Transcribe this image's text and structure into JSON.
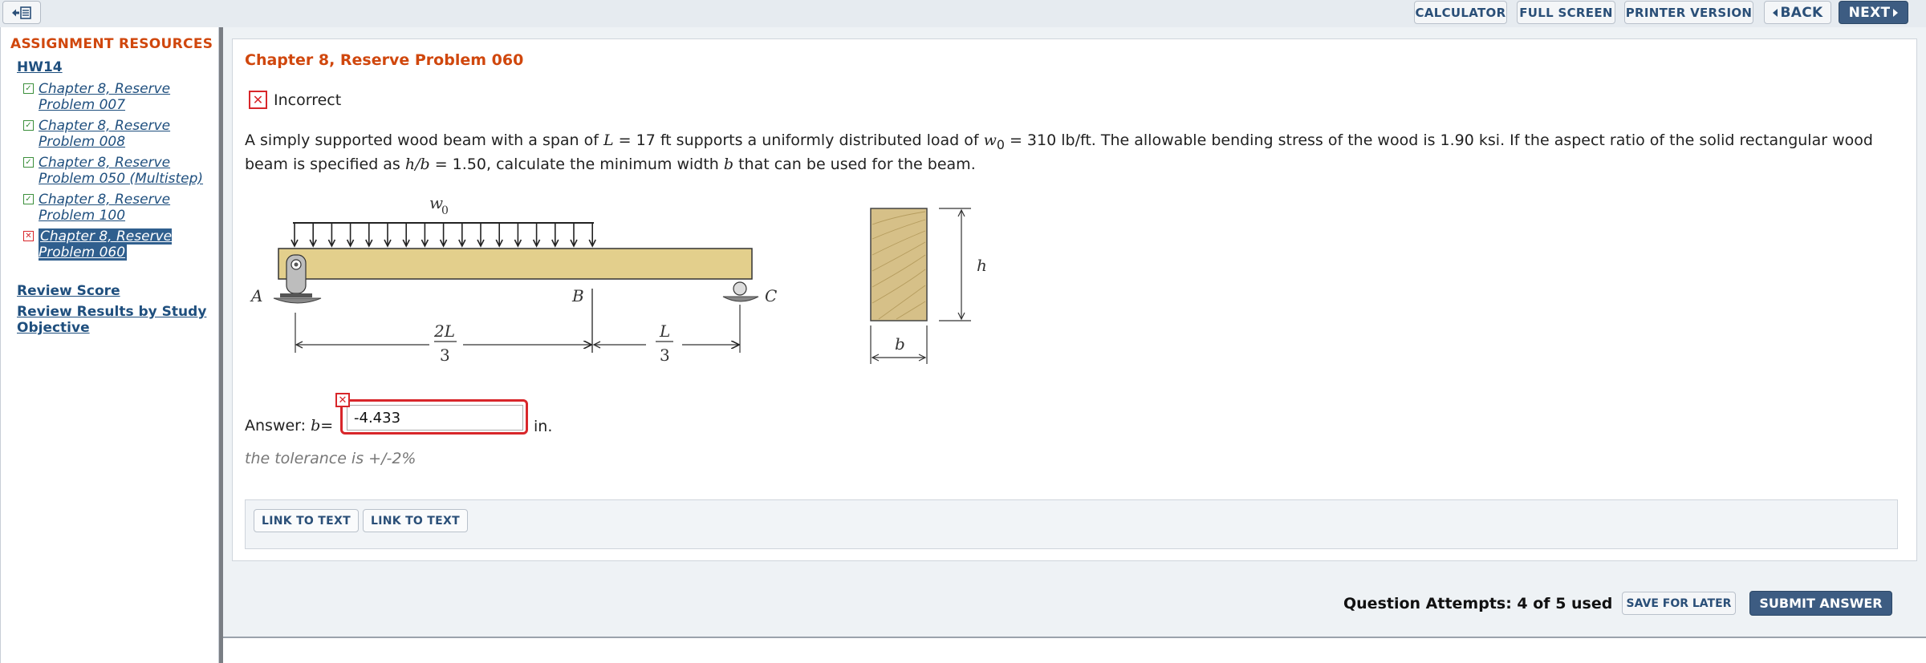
{
  "toolbar": {
    "collapse_icon": "sidebar-toggle-icon",
    "calculator": "CALCULATOR",
    "full_screen": "FULL SCREEN",
    "printer_version": "PRINTER VERSION",
    "back": "BACK",
    "next": "NEXT"
  },
  "sidebar": {
    "title": "ASSIGNMENT RESOURCES",
    "assignment": "HW14",
    "items": [
      {
        "label": "Chapter 8, Reserve Problem 007",
        "status": "correct"
      },
      {
        "label": "Chapter 8, Reserve Problem 008",
        "status": "correct"
      },
      {
        "label": "Chapter 8, Reserve Problem 050 (Multistep)",
        "status": "correct"
      },
      {
        "label": "Chapter 8, Reserve Problem 100",
        "status": "correct"
      },
      {
        "label": "Chapter 8, Reserve Problem 060",
        "status": "incorrect"
      }
    ],
    "review_score": "Review Score",
    "review_results": "Review Results by Study Objective"
  },
  "problem": {
    "title": "Chapter 8, Reserve Problem 060",
    "status": "Incorrect",
    "text_1": "A simply supported wood beam with a span of ",
    "L_sym": "L",
    "text_2": " = 17 ft supports a uniformly distributed load of ",
    "w_sym": "w",
    "w_sub": "0",
    "text_3": " = 310 lb/ft. The allowable bending stress of the wood is 1.90 ksi. If the aspect ratio of the solid rectangular wood beam is specified as ",
    "hb_sym": "h/b",
    "text_4": " = 1.50, calculate the minimum width ",
    "b_sym": "b",
    "text_5": " that can be used for the beam."
  },
  "figure": {
    "load_label": "w",
    "load_sub": "0",
    "point_a": "A",
    "point_b": "B",
    "point_c": "C",
    "dim_left_num": "2L",
    "dim_left_den": "3",
    "dim_right_num": "L",
    "dim_right_den": "3",
    "section_h": "h",
    "section_b": "b",
    "colors": {
      "beam": "#e3cf8c",
      "wood_section": "#d6c088"
    }
  },
  "answer": {
    "prefix": "Answer: ",
    "var": "b",
    "equals": " =",
    "value": "-4.433",
    "unit": "in.",
    "tolerance": "the tolerance is +/-2%"
  },
  "links": [
    "LINK TO TEXT",
    "LINK TO TEXT"
  ],
  "footer": {
    "attempts": "Question Attempts: 4 of 5 used",
    "save_for_later": "SAVE FOR LATER",
    "submit": "SUBMIT ANSWER"
  },
  "colors": {
    "accent_orange": "#d0470d",
    "link_blue": "#1f4f7e",
    "button_navy": "#3d5c82",
    "error_red": "#d8262a"
  }
}
